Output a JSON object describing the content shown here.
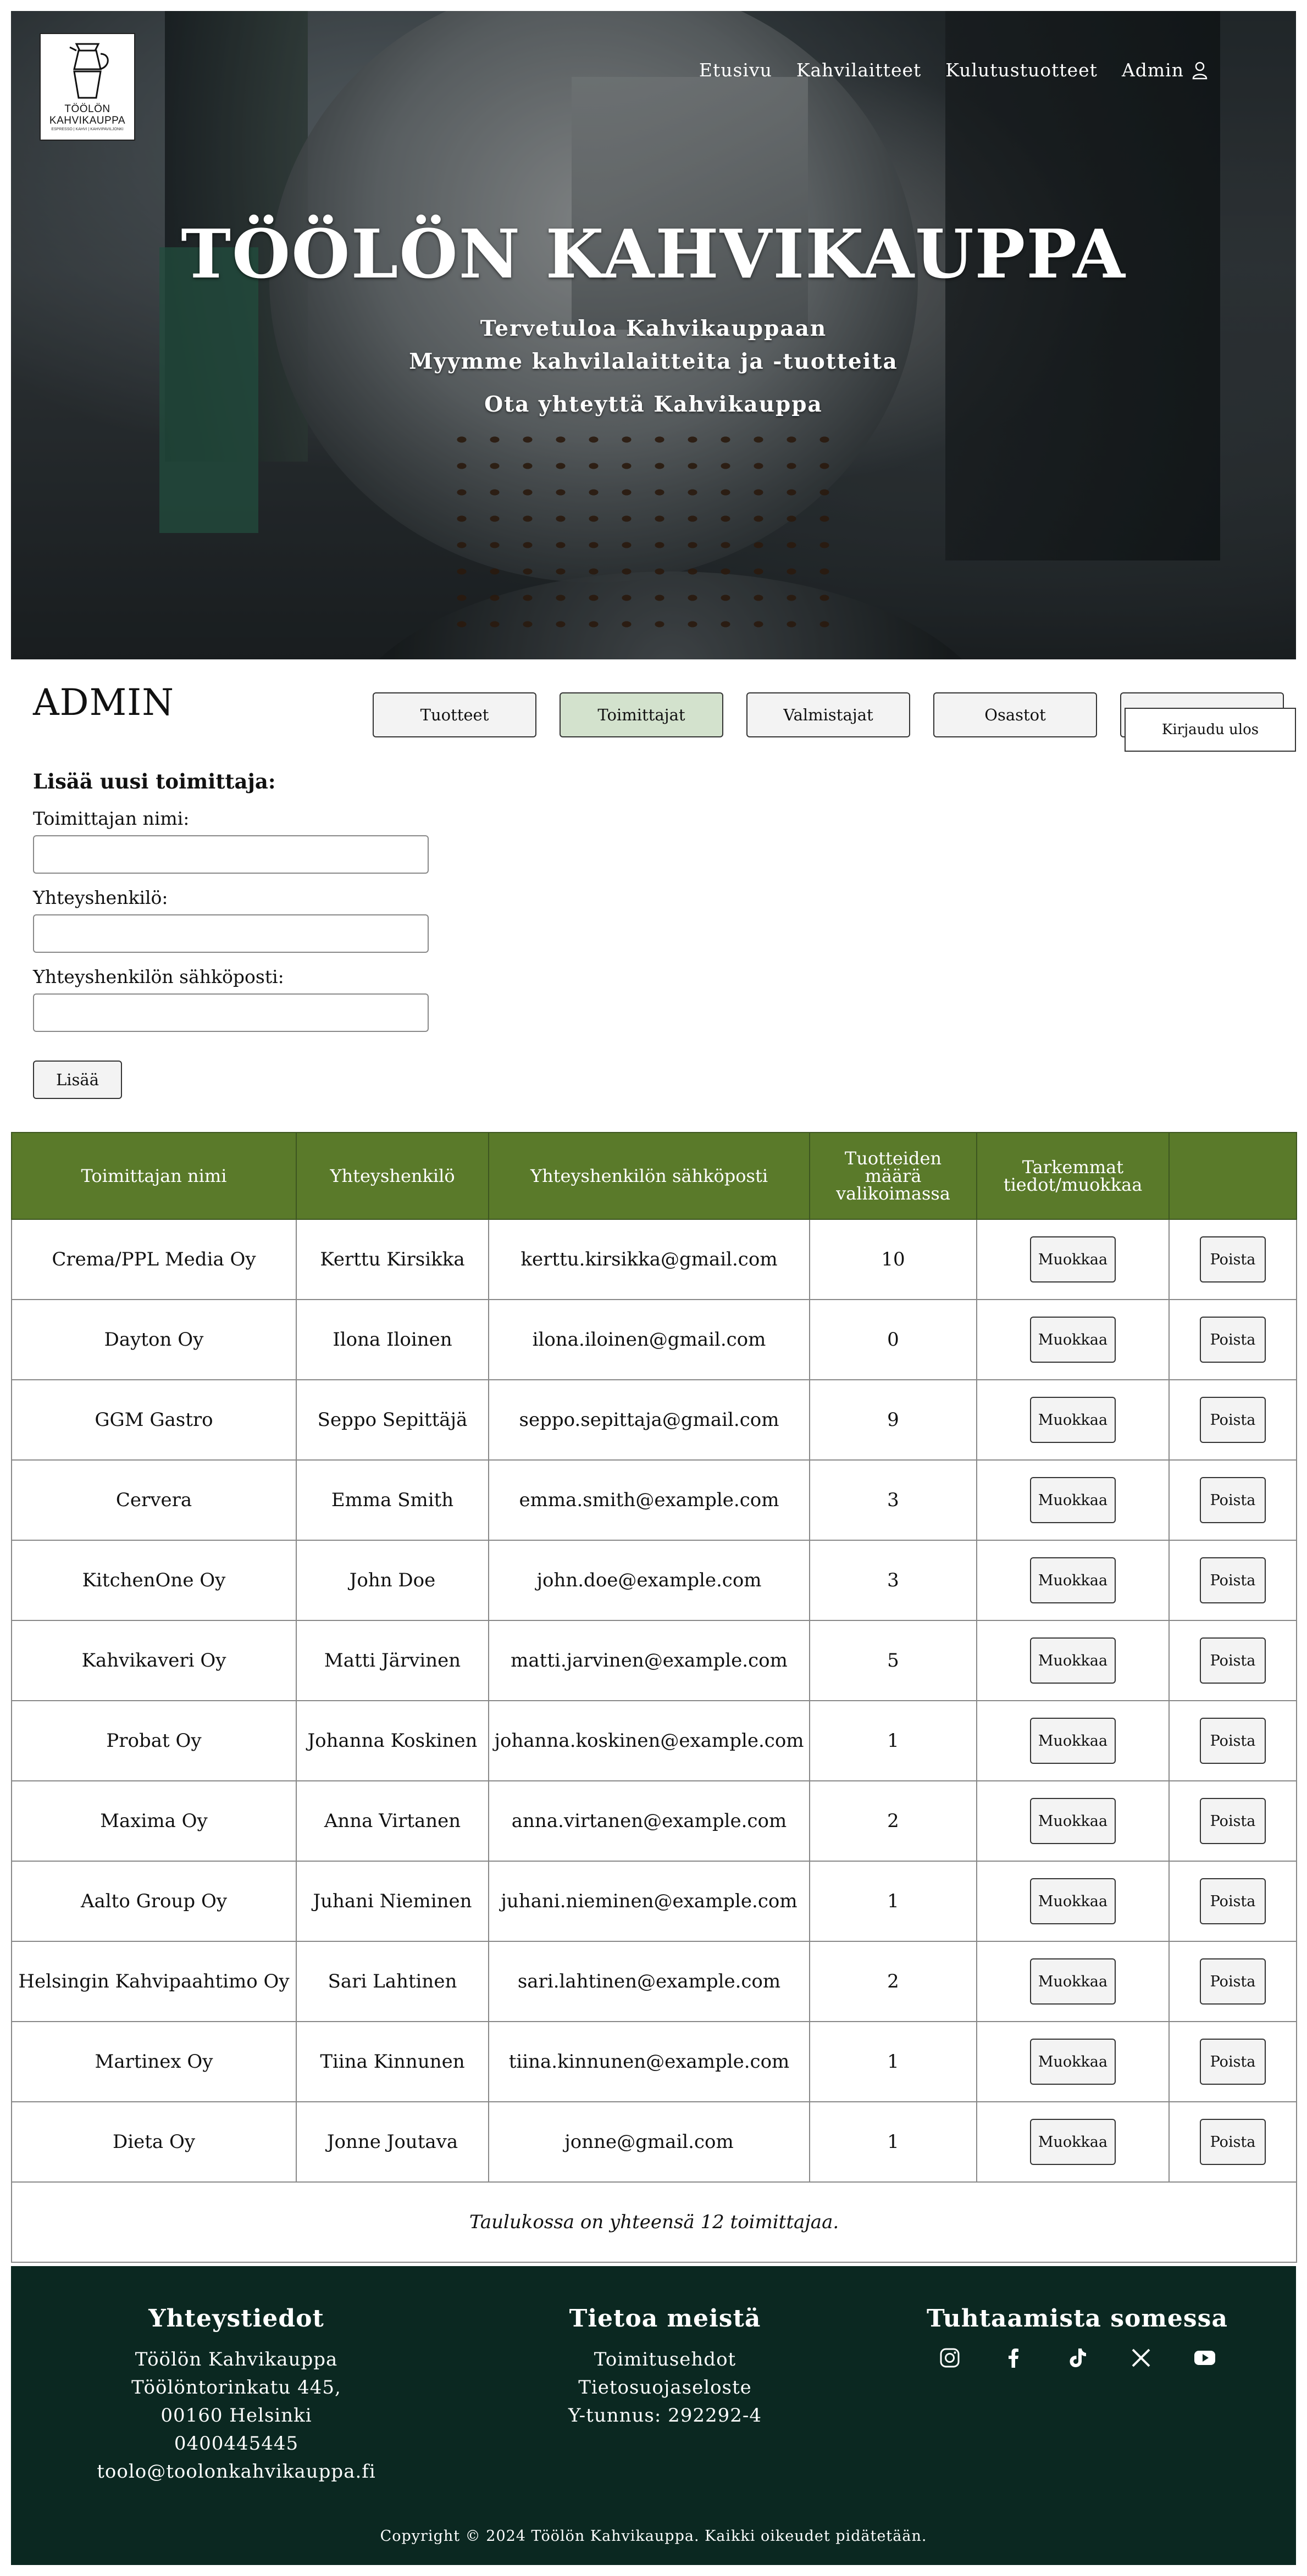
{
  "brand": {
    "logo_line1": "TÖÖLÖN",
    "logo_line2": "KAHVIKAUPPA",
    "logo_line3": "ESPRESSO | KAHVI | KAHVIPAVILJONKI"
  },
  "nav": {
    "items": [
      "Etusivu",
      "Kahvilaitteet",
      "Kulutustuotteet",
      "Admin"
    ]
  },
  "hero": {
    "title": "TÖÖLÖN KAHVIKAUPPA",
    "line1": "Tervetuloa Kahvikauppaan",
    "line2": "Myymme kahvilalaitteita ja -tuotteita",
    "line3": "Ota yhteyttä Kahvikauppa"
  },
  "admin": {
    "title": "ADMIN",
    "tabs": [
      "Tuotteet",
      "Toimittajat",
      "Valmistajat",
      "Osastot"
    ],
    "active_tab": "Toimittajat",
    "logout": "Kirjaudu ulos"
  },
  "form": {
    "heading": "Lisää uusi toimittaja:",
    "name_label": "Toimittajan nimi:",
    "contact_label": "Yhteyshenkilö:",
    "email_label": "Yhteyshenkilön sähköposti:",
    "name_value": "",
    "contact_value": "",
    "email_value": "",
    "submit": "Lisää"
  },
  "table": {
    "headers": [
      "Toimittajan nimi",
      "Yhteyshenkilö",
      "Yhteyshenkilön sähköposti",
      "Tuotteiden määrä valikoimassa",
      "Tarkemmat tiedot/muokkaa",
      ""
    ],
    "edit_label": "Muokkaa",
    "delete_label": "Poista",
    "rows": [
      {
        "name": "Crema/PPL Media Oy",
        "contact": "Kerttu Kirsikka",
        "email": "kerttu.kirsikka@gmail.com",
        "count": "10"
      },
      {
        "name": "Dayton Oy",
        "contact": "Ilona Iloinen",
        "email": "ilona.iloinen@gmail.com",
        "count": "0"
      },
      {
        "name": "GGM Gastro",
        "contact": "Seppo Sepittäjä",
        "email": "seppo.sepittaja@gmail.com",
        "count": "9"
      },
      {
        "name": "Cervera",
        "contact": "Emma Smith",
        "email": "emma.smith@example.com",
        "count": "3"
      },
      {
        "name": "KitchenOne Oy",
        "contact": "John Doe",
        "email": "john.doe@example.com",
        "count": "3"
      },
      {
        "name": "Kahvikaveri Oy",
        "contact": "Matti Järvinen",
        "email": "matti.jarvinen@example.com",
        "count": "5"
      },
      {
        "name": "Probat Oy",
        "contact": "Johanna Koskinen",
        "email": "johanna.koskinen@example.com",
        "count": "1"
      },
      {
        "name": "Maxima Oy",
        "contact": "Anna Virtanen",
        "email": "anna.virtanen@example.com",
        "count": "2"
      },
      {
        "name": "Aalto Group Oy",
        "contact": "Juhani Nieminen",
        "email": "juhani.nieminen@example.com",
        "count": "1"
      },
      {
        "name": "Helsingin Kahvipaahtimo Oy",
        "contact": "Sari Lahtinen",
        "email": "sari.lahtinen@example.com",
        "count": "2"
      },
      {
        "name": "Martinex Oy",
        "contact": "Tiina Kinnunen",
        "email": "tiina.kinnunen@example.com",
        "count": "1"
      },
      {
        "name": "Dieta Oy",
        "contact": "Jonne Joutava",
        "email": "jonne@gmail.com",
        "count": "1"
      }
    ],
    "summary": "Taulukossa on yhteensä 12 toimittajaa."
  },
  "footer": {
    "contact_title": "Yhteystiedot",
    "contact_lines": [
      "Töölön Kahvikauppa",
      "Töölöntorinkatu 445,",
      "00160 Helsinki",
      "0400445445",
      "toolo@toolonkahvikauppa.fi"
    ],
    "about_title": "Tietoa meistä",
    "about_lines": [
      "Toimitusehdot",
      "Tietosuojaseloste",
      "Y-tunnus: 292292-4"
    ],
    "social_title": "Tuhtaamista somessa",
    "social_icons": [
      "instagram-icon",
      "facebook-icon",
      "tiktok-icon",
      "x-icon",
      "youtube-icon"
    ],
    "copyright": "Copyright © 2024 Töölön Kahvikauppa. Kaikki oikeudet pidätetään."
  },
  "colors": {
    "table_header": "#5a7a2a",
    "active_tab": "#d3e2cd",
    "footer_bg": "#0b2821"
  }
}
